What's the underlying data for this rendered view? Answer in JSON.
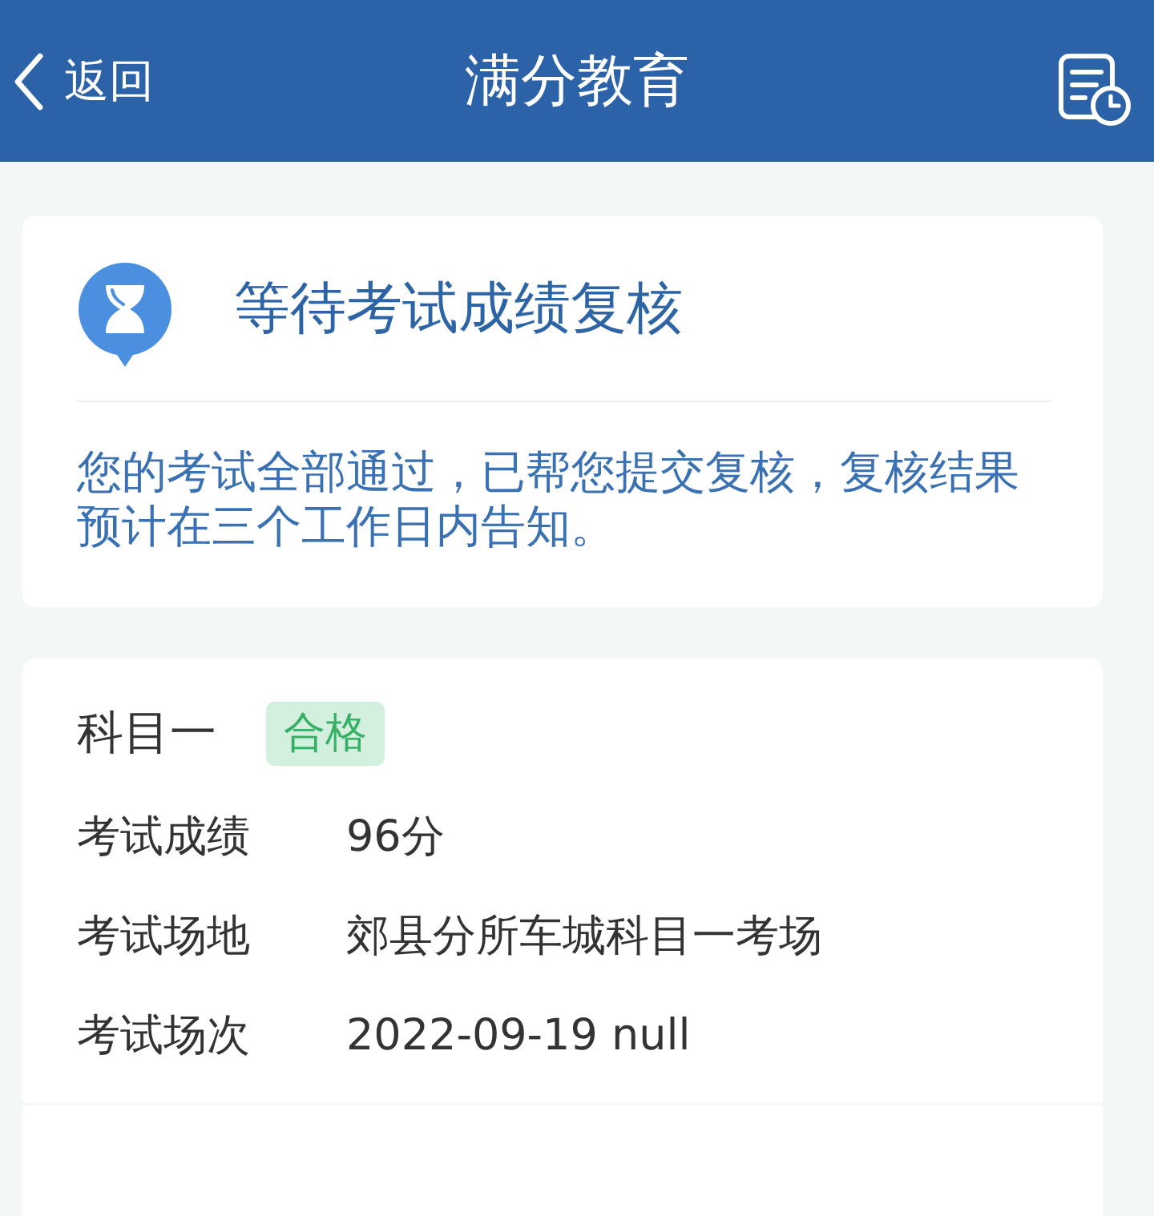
{
  "header": {
    "back_label": "返回",
    "title": "满分教育"
  },
  "status_card": {
    "title": "等待考试成绩复核",
    "message": "您的考试全部通过，已帮您提交复核，复核结果预计在三个工作日内告知。"
  },
  "subjects": [
    {
      "name": "科目一",
      "badge": "合格",
      "fields": [
        {
          "label": "考试成绩",
          "value": "96分"
        },
        {
          "label": "考试场地",
          "value": "郊县分所车城科目一考场"
        },
        {
          "label": "考试场次",
          "value": "2022-09-19 null"
        }
      ]
    }
  ]
}
